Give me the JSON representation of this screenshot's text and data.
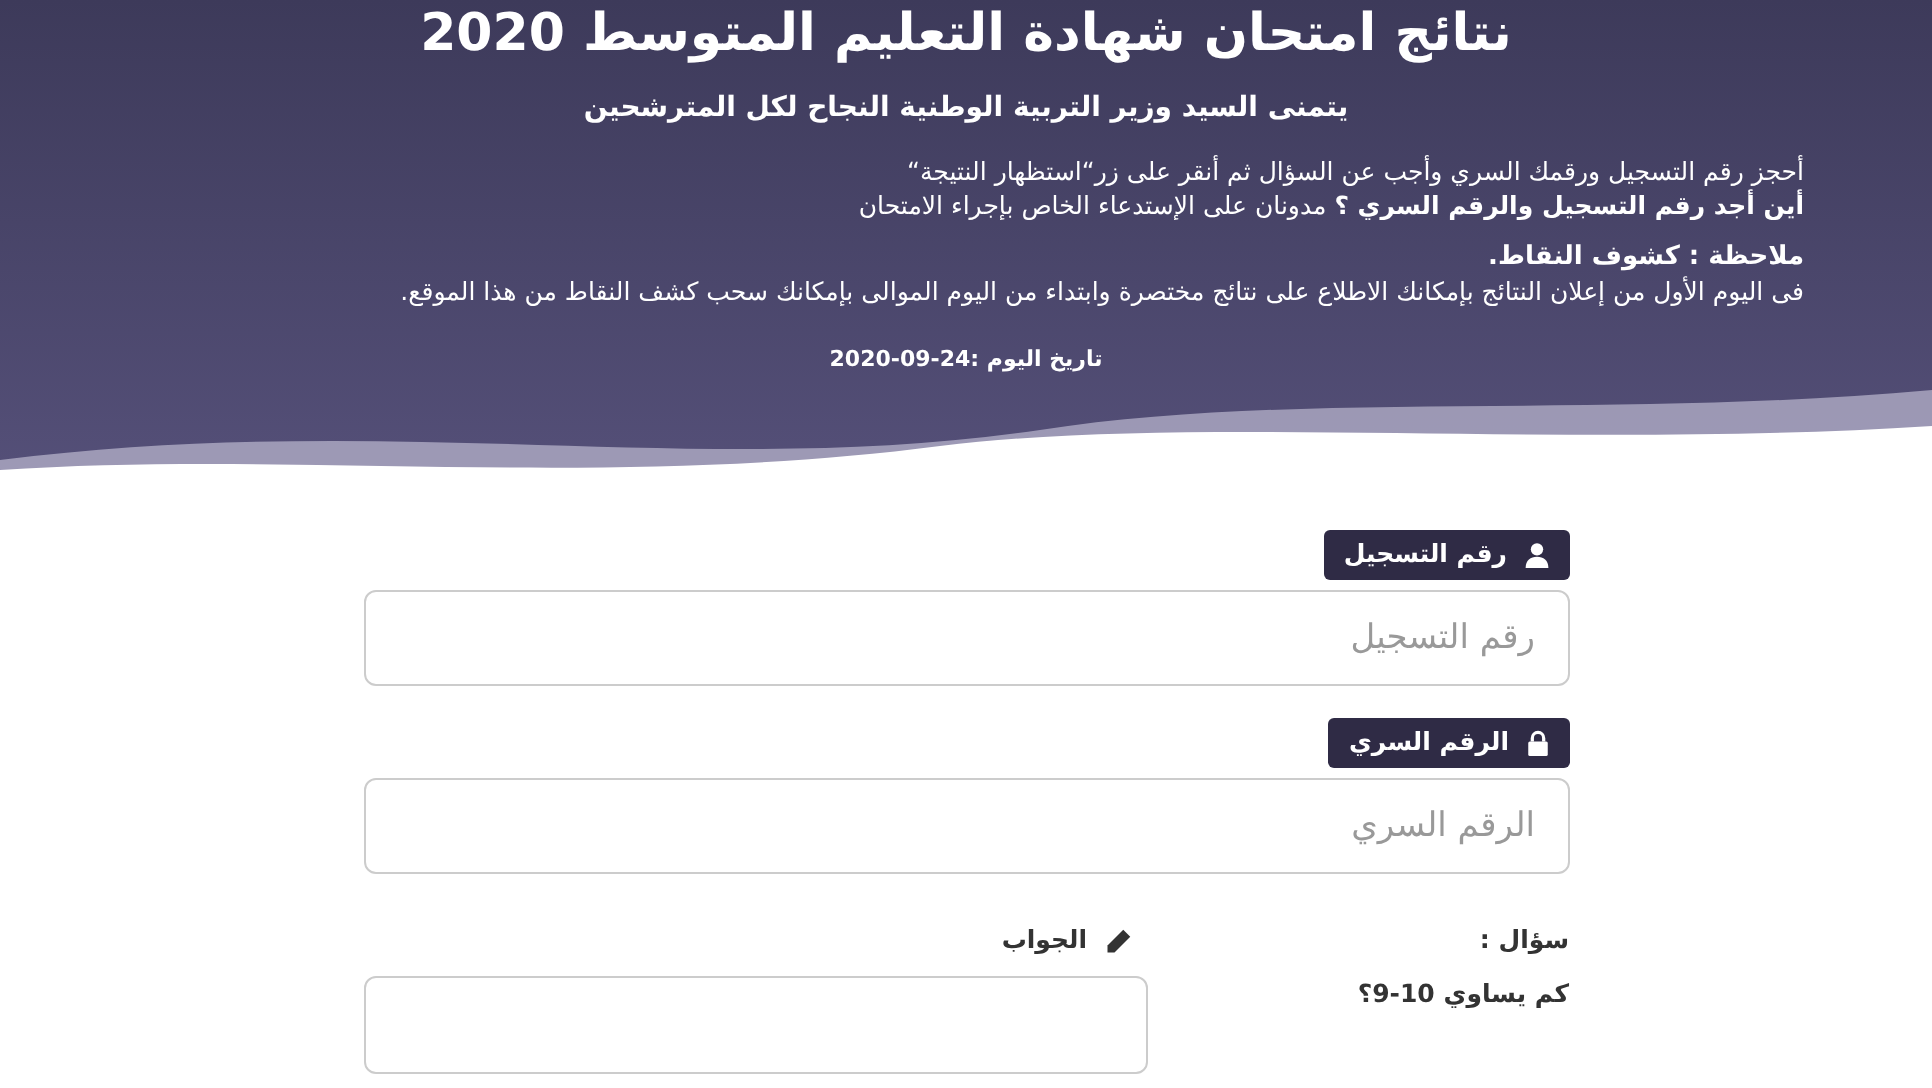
{
  "header": {
    "title": "نتائج امتحان شهادة التعليم المتوسط 2020",
    "subtitle": "يتمنى السيد وزير التربية الوطنية النجاح لكل المترشحين",
    "instructions": [
      "أحجز رقم التسجيل ورقمك السري وأجب عن السؤال ثم أنقر على زر“استظهار النتيجة“",
      "**أين أجد رقم التسجيل والرقم السري ؟** مدونان على الإستدعاء الخاص بإجراء الامتحان"
    ],
    "note_title": "ملاحظة : كشوف النقاط.",
    "note_text": "فى اليوم الأول من إعلان النتائج بإمكانك الاطلاع على نتائج مختصرة وابتداء من اليوم الموالى بإمكانك سحب كشف النقاط من هذا الموقع.",
    "date": "تاريخ اليوم :24-09-2020"
  },
  "fields": [
    {
      "kind": "user",
      "label": "رقم التسجيل",
      "placeholder": "رقم التسجيل"
    },
    {
      "kind": "lock",
      "label": "الرقم السري",
      "placeholder": "الرقم السري"
    }
  ],
  "question": {
    "label": "سؤال :",
    "text": "كم يساوي 10-9؟",
    "answer_label": "الجواب"
  }
}
